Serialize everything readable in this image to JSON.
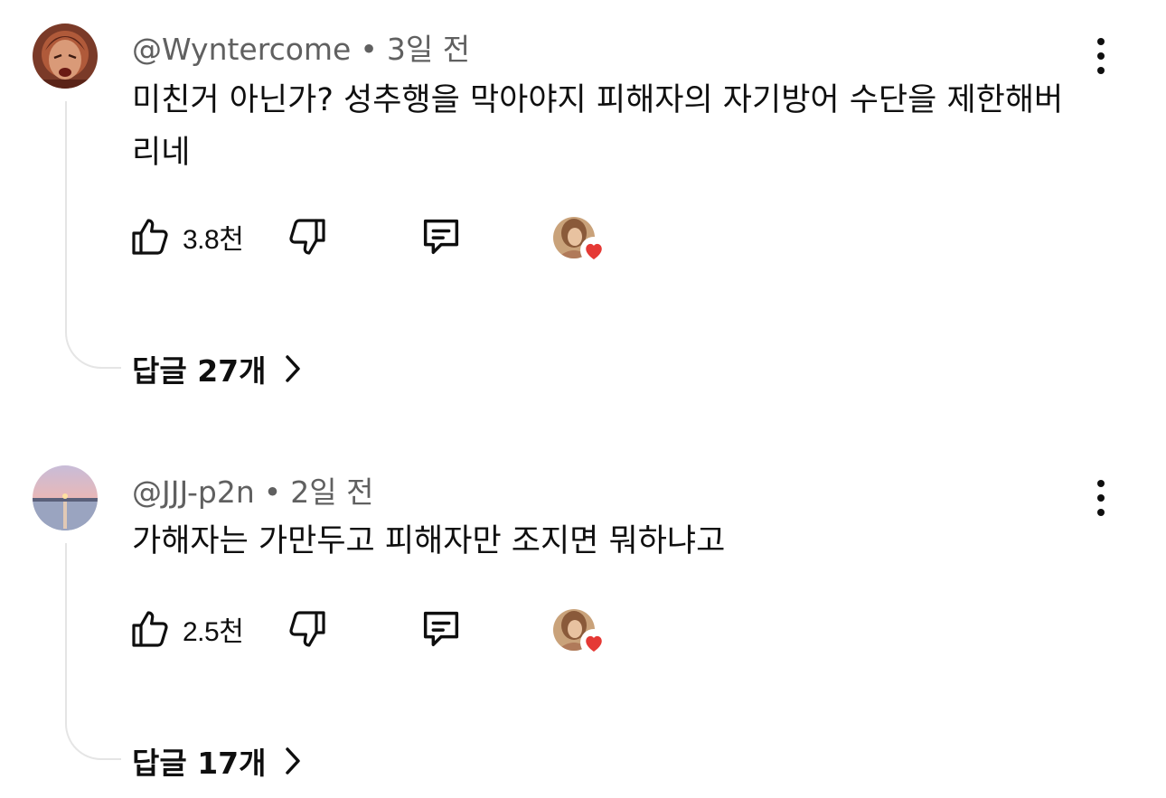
{
  "comments": [
    {
      "author": "@Wyntercome",
      "separator": "•",
      "time": "3일 전",
      "text": "미친거 아닌가? 성추행을 막아야지 피해자의 자기방어 수단을 제한해버리네",
      "likes": "3.8천",
      "replies_label": "답글 27개",
      "avatar_icon": "cartoon-avatar",
      "creator_heart": true
    },
    {
      "author": "@JJJ-p2n",
      "separator": "•",
      "time": "2일 전",
      "text": "가해자는 가만두고 피해자만 조지면 뭐하냐고",
      "likes": "2.5천",
      "replies_label": "답글 17개",
      "avatar_icon": "sunset-avatar",
      "creator_heart": true
    }
  ],
  "colors": {
    "text": "#0f0f0f",
    "meta": "#606060",
    "heart": "#e53935",
    "thread_line": "#e5e5e5"
  }
}
